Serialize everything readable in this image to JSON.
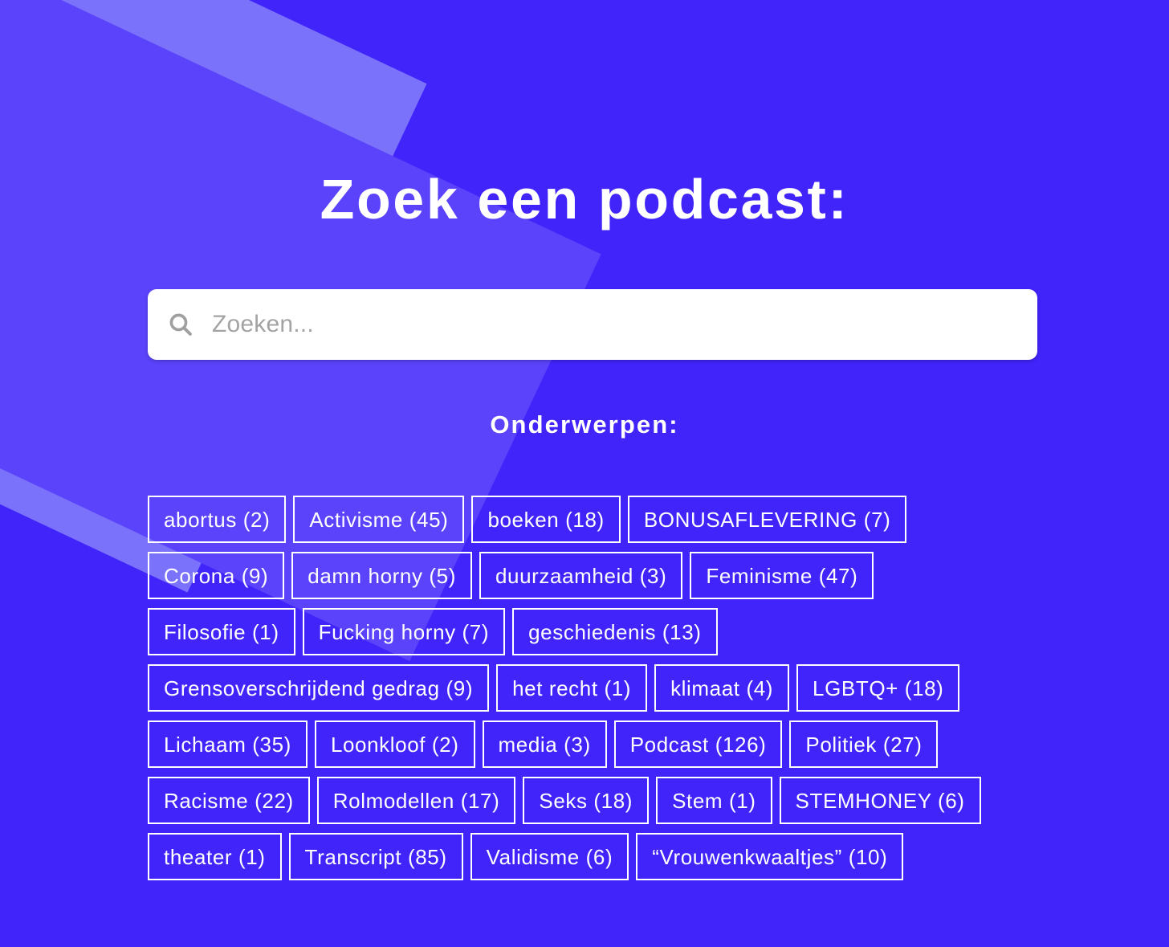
{
  "theme": {
    "background_color": "#4124fa",
    "band_light_color": "#8a86fd",
    "band_mid_color": "#7a72fb",
    "band_dark_color": "#5a43fb",
    "text_color": "#ffffff",
    "search_background": "#ffffff",
    "placeholder_color": "#a3a3a3"
  },
  "page": {
    "title": "Zoek een podcast:"
  },
  "search": {
    "icon": "search-icon",
    "value": "",
    "placeholder": "Zoeken..."
  },
  "topics": {
    "heading": "Onderwerpen:",
    "items": [
      {
        "label": "abortus (2)",
        "name": "abortus",
        "count": 2
      },
      {
        "label": "Activisme (45)",
        "name": "Activisme",
        "count": 45
      },
      {
        "label": "boeken (18)",
        "name": "boeken",
        "count": 18
      },
      {
        "label": "BONUSAFLEVERING (7)",
        "name": "BONUSAFLEVERING",
        "count": 7
      },
      {
        "label": "Corona (9)",
        "name": "Corona",
        "count": 9
      },
      {
        "label": "damn horny (5)",
        "name": "damn horny",
        "count": 5
      },
      {
        "label": "duurzaamheid (3)",
        "name": "duurzaamheid",
        "count": 3
      },
      {
        "label": "Feminisme (47)",
        "name": "Feminisme",
        "count": 47
      },
      {
        "label": "Filosofie (1)",
        "name": "Filosofie",
        "count": 1
      },
      {
        "label": "Fucking horny (7)",
        "name": "Fucking horny",
        "count": 7
      },
      {
        "label": "geschiedenis (13)",
        "name": "geschiedenis",
        "count": 13
      },
      {
        "label": "Grensoverschrijdend gedrag (9)",
        "name": "Grensoverschrijdend gedrag",
        "count": 9
      },
      {
        "label": "het recht (1)",
        "name": "het recht",
        "count": 1
      },
      {
        "label": "klimaat (4)",
        "name": "klimaat",
        "count": 4
      },
      {
        "label": "LGBTQ+ (18)",
        "name": "LGBTQ+",
        "count": 18
      },
      {
        "label": "Lichaam (35)",
        "name": "Lichaam",
        "count": 35
      },
      {
        "label": "Loonkloof (2)",
        "name": "Loonkloof",
        "count": 2
      },
      {
        "label": "media (3)",
        "name": "media",
        "count": 3
      },
      {
        "label": "Podcast (126)",
        "name": "Podcast",
        "count": 126
      },
      {
        "label": "Politiek (27)",
        "name": "Politiek",
        "count": 27
      },
      {
        "label": "Racisme (22)",
        "name": "Racisme",
        "count": 22
      },
      {
        "label": "Rolmodellen (17)",
        "name": "Rolmodellen",
        "count": 17
      },
      {
        "label": "Seks (18)",
        "name": "Seks",
        "count": 18
      },
      {
        "label": "Stem (1)",
        "name": "Stem",
        "count": 1
      },
      {
        "label": "STEMHONEY (6)",
        "name": "STEMHONEY",
        "count": 6
      },
      {
        "label": "theater (1)",
        "name": "theater",
        "count": 1
      },
      {
        "label": "Transcript (85)",
        "name": "Transcript",
        "count": 85
      },
      {
        "label": "Validisme (6)",
        "name": "Validisme",
        "count": 6
      },
      {
        "label": "“Vrouwenkwaaltjes” (10)",
        "name": "“Vrouwenkwaaltjes”",
        "count": 10
      }
    ]
  }
}
